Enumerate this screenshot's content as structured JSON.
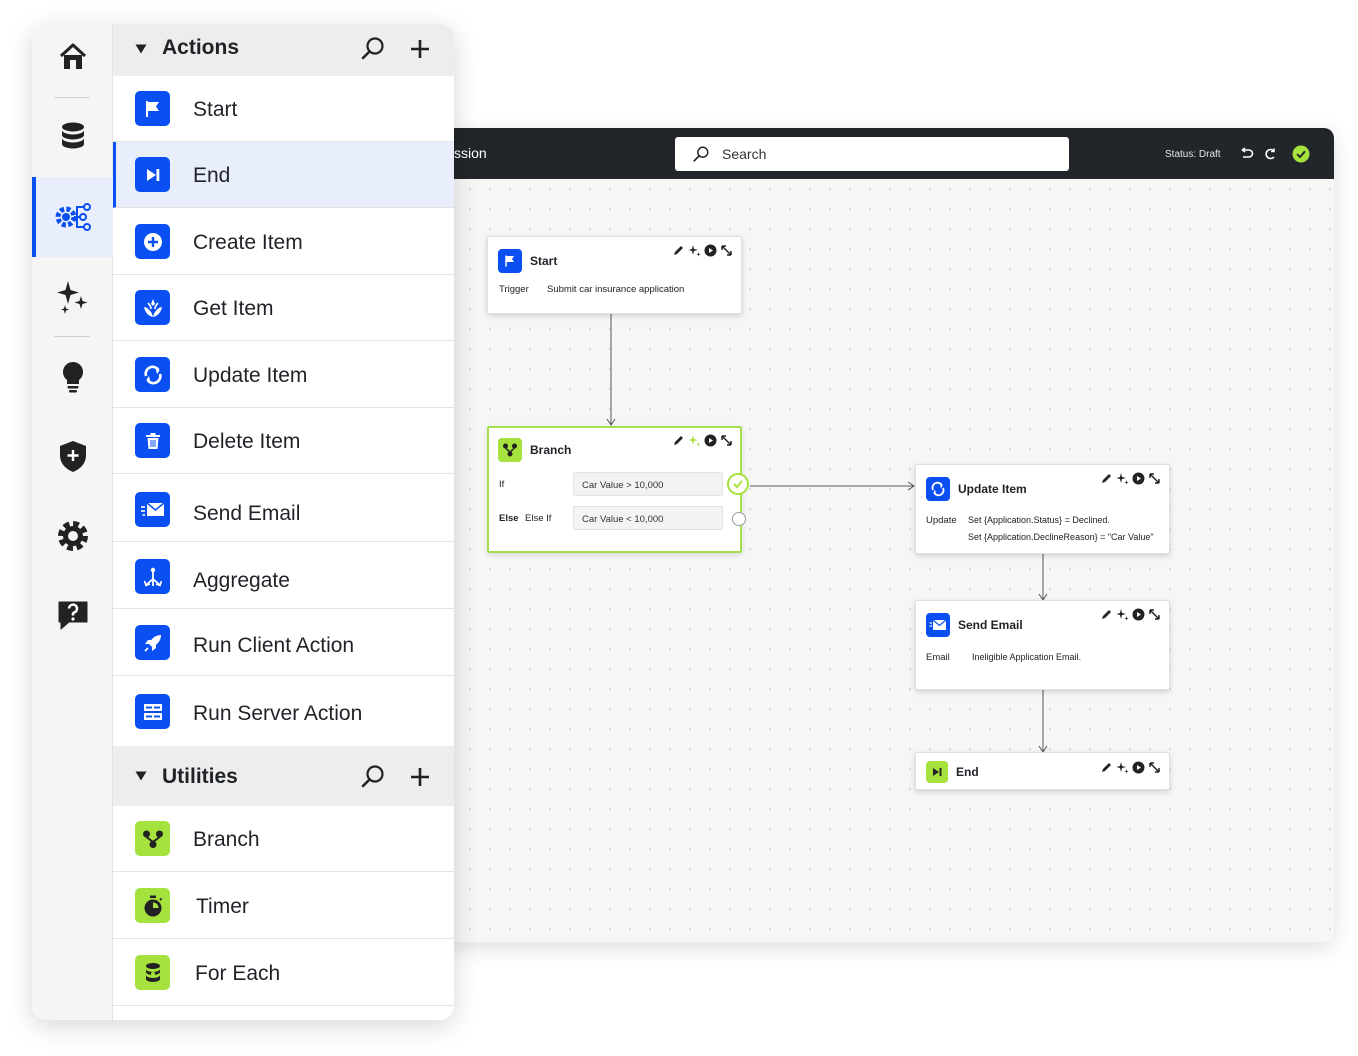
{
  "canvas": {
    "title_fragment": "ssion",
    "search": {
      "placeholder": "Search"
    },
    "status_text": "Status: Draft",
    "icons": {
      "search": "search-icon",
      "undo": "undo-icon",
      "redo": "redo-icon",
      "saved": "check-circle-icon"
    }
  },
  "nodes": {
    "start": {
      "title": "Start",
      "label": "Trigger",
      "value": "Submit car insurance application"
    },
    "branch": {
      "title": "Branch",
      "if_label": "If",
      "if_value": "Car Value > 10,000",
      "else_label": "Else",
      "elseif_label": "Else If",
      "elseif_value": "Car Value < 10,000"
    },
    "update": {
      "title": "Update Item",
      "label": "Update",
      "line1": "Set {Application.Status} = Declined.",
      "line2": "Set {Application.DeclineReason} = \"Car Value\""
    },
    "email": {
      "title": "Send Email",
      "label": "Email",
      "value": "Ineligible Application Email."
    },
    "end": {
      "title": "End"
    },
    "tool_icons": [
      "pencil-icon",
      "sparkle-icon",
      "play-icon",
      "expand-icon"
    ]
  },
  "rail": {
    "items": [
      "home-icon",
      "database-icon",
      "workflow-gear-icon",
      "sparkles-icon",
      "lightbulb-icon",
      "shield-plus-icon",
      "gear-icon",
      "help-icon"
    ],
    "active": "workflow-gear-icon"
  },
  "actions": {
    "title": "Actions",
    "items": [
      {
        "label": "Start",
        "icon": "flag-icon"
      },
      {
        "label": "End",
        "icon": "skip-end-icon"
      },
      {
        "label": "Create Item",
        "icon": "plus-circle-icon"
      },
      {
        "label": "Get Item",
        "icon": "hand-icon"
      },
      {
        "label": "Update Item",
        "icon": "refresh-icon"
      },
      {
        "label": "Delete Item",
        "icon": "trash-icon"
      },
      {
        "label": "Send Email",
        "icon": "email-icon"
      },
      {
        "label": "Aggregate",
        "icon": "aggregate-icon"
      },
      {
        "label": "Run Client Action",
        "icon": "rocket-icon"
      },
      {
        "label": "Run Server Action",
        "icon": "server-icon"
      }
    ],
    "active": "End"
  },
  "utilities": {
    "title": "Utilities",
    "items": [
      {
        "label": "Branch",
        "icon": "branch-icon"
      },
      {
        "label": "Timer",
        "icon": "timer-icon"
      },
      {
        "label": "For Each",
        "icon": "stack-icon"
      }
    ]
  },
  "colors": {
    "accent": "#0a4ff2",
    "utility": "#a6e23e",
    "topbar": "#22262a",
    "active_bg": "#e8eefc"
  }
}
